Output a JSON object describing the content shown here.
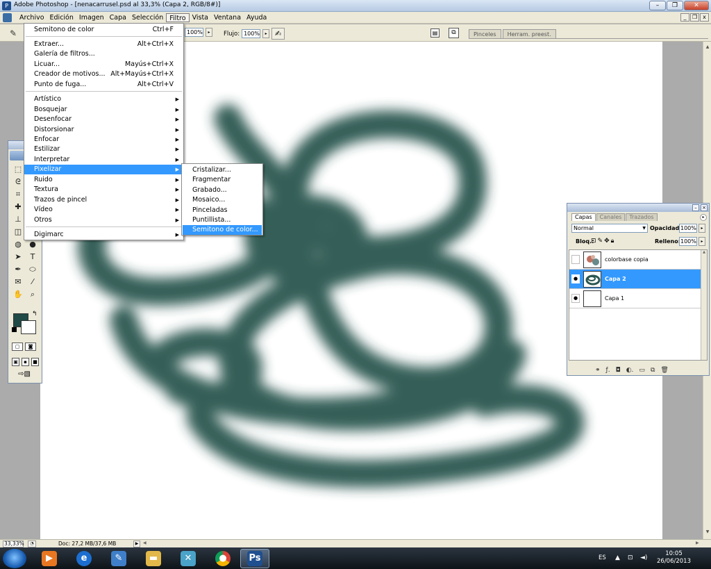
{
  "window": {
    "title": "Adobe Photoshop - [nenacarrusel.psd al 33,3% (Capa 2, RGB/8#)]",
    "buttons": [
      "–",
      "❐",
      "✕"
    ]
  },
  "menubar": {
    "items": [
      "Archivo",
      "Edición",
      "Imagen",
      "Capa",
      "Selección",
      "Filtro",
      "Vista",
      "Ventana",
      "Ayuda"
    ],
    "open_item": "Filtro",
    "doc_buttons": [
      "_",
      "❐",
      "x"
    ]
  },
  "options": {
    "opacity_value": "100%",
    "flow_label": "Flujo:",
    "flow_value": "100%",
    "well_tabs": [
      "Pinceles",
      "Herram. preest."
    ]
  },
  "filter_menu": {
    "items": [
      {
        "label": "Semitono de color",
        "shortcut": "Ctrl+F"
      },
      {
        "label": "Extraer...",
        "shortcut": "Alt+Ctrl+X"
      },
      {
        "label": "Galería de filtros...",
        "shortcut": ""
      },
      {
        "label": "Licuar...",
        "shortcut": "Mayús+Ctrl+X"
      },
      {
        "label": "Creador de motivos...",
        "shortcut": "Alt+Mayús+Ctrl+X"
      },
      {
        "label": "Punto de fuga...",
        "shortcut": "Alt+Ctrl+V"
      },
      {
        "label": "Artístico",
        "shortcut": ""
      },
      {
        "label": "Bosquejar",
        "shortcut": ""
      },
      {
        "label": "Desenfocar",
        "shortcut": ""
      },
      {
        "label": "Distorsionar",
        "shortcut": ""
      },
      {
        "label": "Enfocar",
        "shortcut": ""
      },
      {
        "label": "Estilizar",
        "shortcut": ""
      },
      {
        "label": "Interpretar",
        "shortcut": ""
      },
      {
        "label": "Pixelizar",
        "shortcut": ""
      },
      {
        "label": "Ruido",
        "shortcut": ""
      },
      {
        "label": "Textura",
        "shortcut": ""
      },
      {
        "label": "Trazos de pincel",
        "shortcut": ""
      },
      {
        "label": "Vídeo",
        "shortcut": ""
      },
      {
        "label": "Otros",
        "shortcut": ""
      },
      {
        "label": "Digimarc",
        "shortcut": ""
      }
    ],
    "highlighted": "Pixelizar"
  },
  "pixelizar_submenu": {
    "items": [
      "Cristalizar...",
      "Fragmentar",
      "Grabado...",
      "Mosaico...",
      "Pinceladas",
      "Puntillista...",
      "Semitono de color..."
    ],
    "highlighted": "Semitono de color..."
  },
  "layers_panel": {
    "tabs": [
      "Capas",
      "Canales",
      "Trazados"
    ],
    "active_tab": "Capas",
    "blend_mode": "Normal",
    "opacity_label": "Opacidad:",
    "opacity_value": "100%",
    "lock_label": "Bloq.:",
    "fill_label": "Relleno:",
    "fill_value": "100%",
    "layers": [
      {
        "name": "colorbase copia",
        "visible": false,
        "selected": false
      },
      {
        "name": "Capa 2",
        "visible": true,
        "selected": true
      },
      {
        "name": "Capa 1",
        "visible": true,
        "selected": false
      }
    ]
  },
  "status": {
    "zoom": "33,33%",
    "doc_info": "Doc: 27,2 MB/37,6 MB"
  },
  "taskbar": {
    "language": "ES",
    "time": "10:05",
    "date": "26/06/2013"
  },
  "colors": {
    "foreground": "#1f4a45",
    "background": "#ffffff",
    "highlight": "#3399ff",
    "stroke": "#2c5650"
  }
}
